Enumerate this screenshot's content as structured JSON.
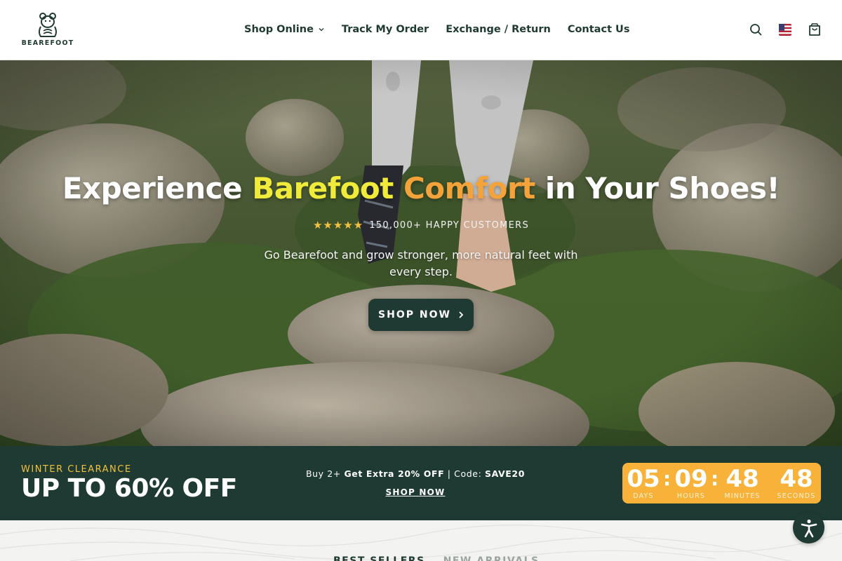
{
  "brand": {
    "name": "BEAREFOOT"
  },
  "nav": {
    "items": [
      {
        "label": "Shop Online",
        "has_dropdown": true
      },
      {
        "label": "Track My Order"
      },
      {
        "label": "Exchange / Return"
      },
      {
        "label": "Contact Us"
      }
    ]
  },
  "header_icons": [
    "search-icon",
    "us-flag-icon",
    "shopping-bag-icon"
  ],
  "hero": {
    "title_part1": "Experience ",
    "title_yellow": "Barefoot",
    "title_orange": "Comfort",
    "title_part3": "in Your Shoes!",
    "stars": "★★★★★",
    "rating_text": "150,000+ HAPPY CUSTOMERS",
    "subtitle": "Go Bearefoot and grow stronger, more natural feet with every step.",
    "cta_label": "SHOP NOW"
  },
  "promo": {
    "kicker": "WINTER CLEARANCE",
    "headline": "UP TO 60% OFF",
    "offer_prefix": "Buy 2+ ",
    "offer_bold": "Get Extra 20% OFF",
    "offer_mid": " | Code: ",
    "offer_code": "SAVE20",
    "link_label": "SHOP NOW",
    "countdown": [
      {
        "value": "05",
        "label": "DAYS"
      },
      {
        "value": "09",
        "label": "HOURS"
      },
      {
        "value": "48",
        "label": "MINUTES"
      },
      {
        "value": "48",
        "label": "SECONDS"
      }
    ]
  },
  "section_tabs": {
    "first": "BEST SELLERS",
    "second": "NEW ARRIVALS"
  },
  "colors": {
    "brand_green": "#1e3a32",
    "accent_yellow": "#f0ea3a",
    "accent_orange": "#f4a33b",
    "countdown_bg": "#f8b23a",
    "star": "#f3c13f"
  }
}
